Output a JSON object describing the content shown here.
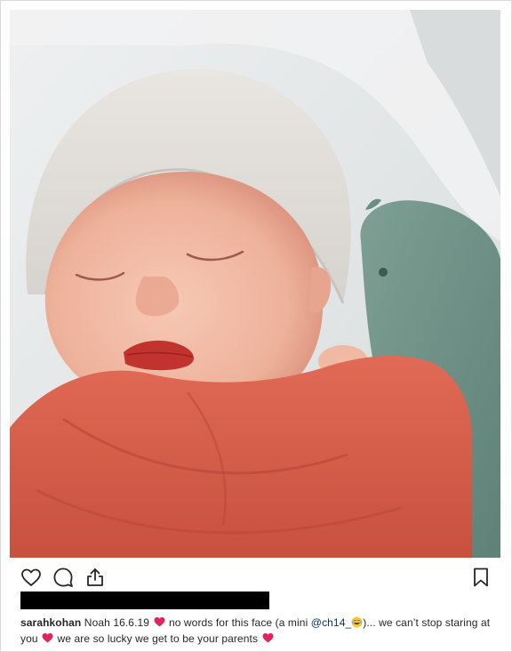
{
  "post": {
    "image_alt": "",
    "caption": {
      "username": "sarahkohan",
      "part1": "Noah 16.6.19",
      "part2": "no words for this face (a mini",
      "mention": "@ch14_",
      "part3": ")... we can’t stop staring at you",
      "part4": "we are so lucky we get to be your parents"
    },
    "icons": {
      "like": "heart-outline-icon",
      "comment": "comment-bubble-icon",
      "share": "share-upload-icon",
      "save": "bookmark-icon",
      "inline_heart": "red-heart-emoji-icon",
      "inline_laugh": "laughing-crying-emoji-icon"
    },
    "colors": {
      "text": "#262626",
      "mention": "#003569",
      "heart": "#e0245e",
      "redaction": "#000000"
    }
  }
}
